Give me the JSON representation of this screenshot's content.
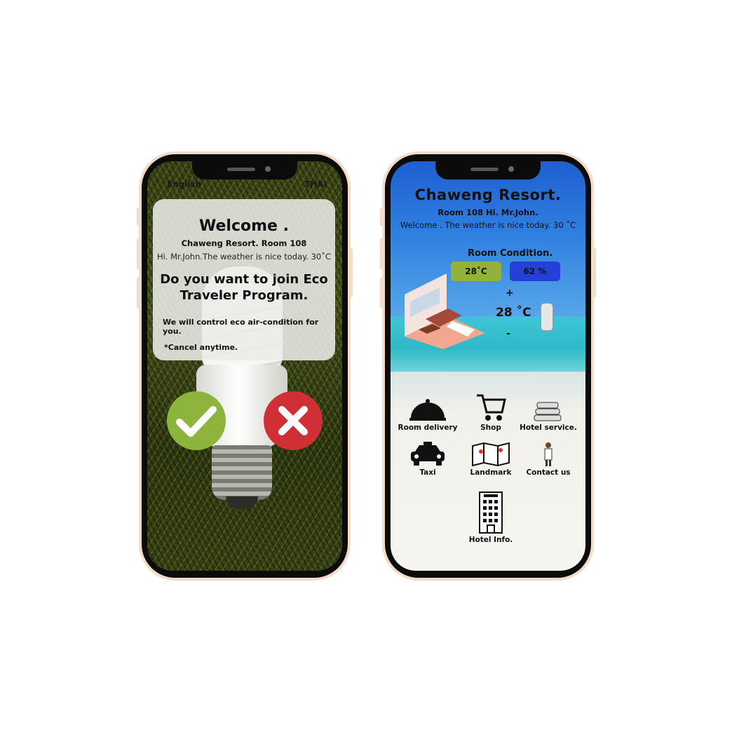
{
  "left_phone": {
    "lang_left": "English",
    "lang_right": "THAI",
    "welcome_title": "Welcome .",
    "resort_line": "Chaweng  Resort. Room  108",
    "greeting": "Hi. Mr.John.The weather is nice today. 30˚C",
    "question": "Do you want to join Eco Traveler Program.",
    "note": "We will control eco air-condition for you.",
    "cancel_note": "*Cancel anytime.",
    "accept_icon": "check-icon",
    "decline_icon": "close-icon",
    "colors": {
      "accept": "#8db43c",
      "decline": "#cf2f35"
    }
  },
  "right_phone": {
    "title": "Chaweng  Resort.",
    "room_line": "Room  108  Hi. Mr.John.",
    "greeting": "Welcome . The weather is nice today.  30 ˚C",
    "room_condition_label": "Room Condition.",
    "temperature_pill": "28˚C",
    "humidity_pill": "62 %",
    "plus": "+",
    "set_temp": "28 ˚C",
    "minus": "-",
    "services": [
      {
        "label": "Room delivery",
        "icon": "cloche-icon"
      },
      {
        "label": "Shop",
        "icon": "cart-icon"
      },
      {
        "label": "Hotel service.",
        "icon": "towels-icon"
      },
      {
        "label": "Taxi",
        "icon": "taxi-icon"
      },
      {
        "label": "Landmark",
        "icon": "map-icon"
      },
      {
        "label": "Contact us",
        "icon": "staff-icon"
      },
      {
        "label": "Hotel Info.",
        "icon": "hotel-building-icon"
      }
    ],
    "colors": {
      "temp_pill": "#93b23a",
      "humidity_pill": "#2540d6"
    }
  }
}
